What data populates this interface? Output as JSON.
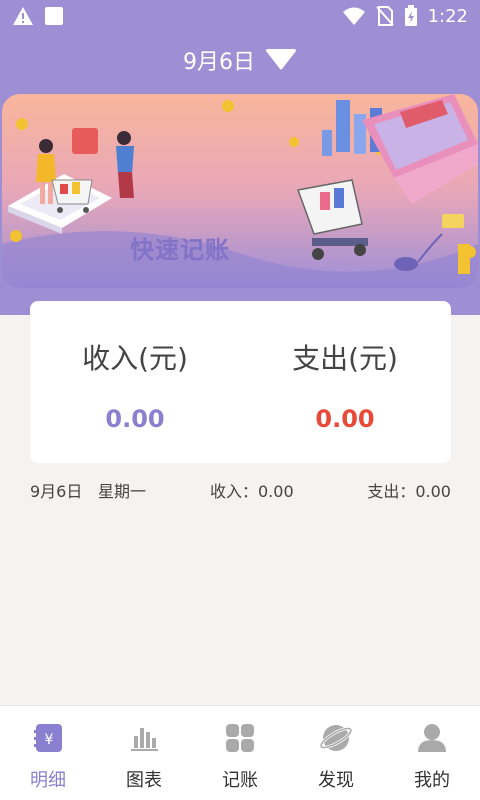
{
  "status_bar": {
    "time": "1:22",
    "icons": [
      "warning-icon",
      "square-icon",
      "wifi-icon",
      "no-sim-icon",
      "battery-icon"
    ]
  },
  "header": {
    "date": "9月6日",
    "dropdown_icon": "triangle-down-icon"
  },
  "banner": {
    "text": "快速记账"
  },
  "summary_card": {
    "income_label": "收入(元)",
    "income_value": "0.00",
    "expense_label": "支出(元)",
    "expense_value": "0.00"
  },
  "day_row": {
    "date": "9月6日",
    "weekday": "星期一",
    "income": "收入：0.00",
    "expense": "支出：0.00"
  },
  "tabs": [
    {
      "label": "明细",
      "icon": "notebook-yen-icon",
      "active": true
    },
    {
      "label": "图表",
      "icon": "bar-chart-icon",
      "active": false
    },
    {
      "label": "记账",
      "icon": "grid-icon",
      "active": false
    },
    {
      "label": "发现",
      "icon": "planet-icon",
      "active": false
    },
    {
      "label": "我的",
      "icon": "person-icon",
      "active": false
    }
  ],
  "colors": {
    "primary": "#9c8fd3",
    "income": "#8b7fd0",
    "expense": "#e84a3a",
    "background": "#f5f2f0"
  }
}
